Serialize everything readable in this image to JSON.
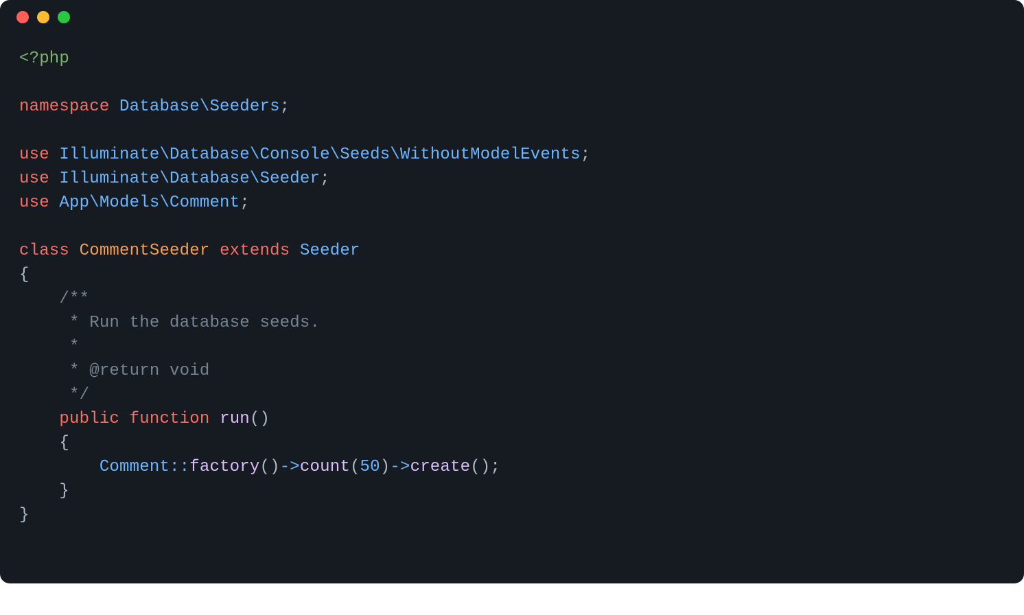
{
  "code": {
    "open_tag": "<?php",
    "kw_namespace": "namespace",
    "ns_value": "Database\\Seeders",
    "kw_use": "use",
    "use1": "Illuminate\\Database\\Console\\Seeds\\WithoutModelEvents",
    "use2": "Illuminate\\Database\\Seeder",
    "use3": "App\\Models\\Comment",
    "kw_class": "class",
    "class_name": "CommentSeeder",
    "kw_extends": "extends",
    "parent_class": "Seeder",
    "comment_l1": "/**",
    "comment_l2": " * Run the database seeds.",
    "comment_l3": " *",
    "comment_l4": " * @return void",
    "comment_l5": " */",
    "kw_public": "public",
    "kw_function": "function",
    "fn_run": "run",
    "call_target": "Comment",
    "dblcolon": "::",
    "fn_factory": "factory",
    "arrow": "->",
    "fn_count": "count",
    "num_50": "50",
    "fn_create": "create",
    "semi": ";",
    "lbrace": "{",
    "rbrace": "}",
    "lparen": "(",
    "rparen": ")"
  }
}
